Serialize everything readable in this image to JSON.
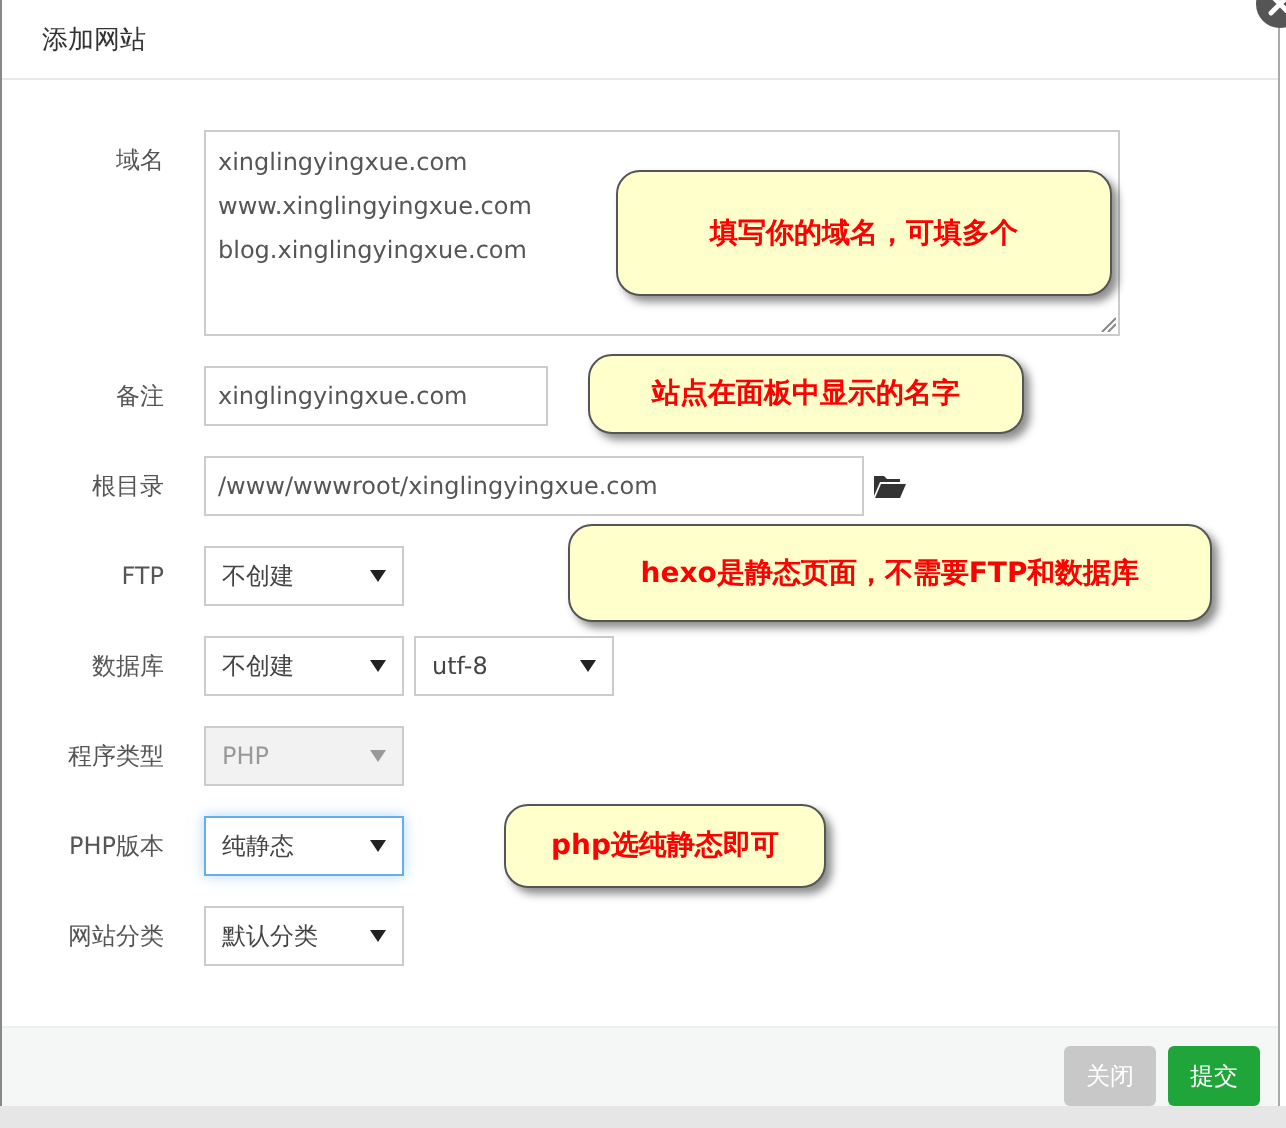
{
  "dialog": {
    "title": "添加网站"
  },
  "fields": [
    {
      "label": "域名",
      "kind": "textarea",
      "lines": [
        "xinglingyingxue.com",
        "www.xinglingyingxue.com",
        "blog.xinglingyingxue.com"
      ]
    },
    {
      "label": "备注",
      "kind": "input",
      "value": "xinglingyingxue.com"
    },
    {
      "label": "根目录",
      "kind": "path",
      "value": "/www/wwwroot/xinglingyingxue.com"
    },
    {
      "label": "FTP",
      "kind": "select",
      "selects": [
        {
          "value": "不创建",
          "disabled": false,
          "focused": false
        }
      ]
    },
    {
      "label": "数据库",
      "kind": "select",
      "selects": [
        {
          "value": "不创建",
          "disabled": false,
          "focused": false
        },
        {
          "value": "utf-8",
          "disabled": false,
          "focused": false
        }
      ]
    },
    {
      "label": "程序类型",
      "kind": "select",
      "selects": [
        {
          "value": "PHP",
          "disabled": true,
          "focused": false
        }
      ]
    },
    {
      "label": "PHP版本",
      "kind": "select",
      "selects": [
        {
          "value": "纯静态",
          "disabled": false,
          "focused": true
        }
      ]
    },
    {
      "label": "网站分类",
      "kind": "select",
      "selects": [
        {
          "value": "默认分类",
          "disabled": false,
          "focused": false
        }
      ]
    }
  ],
  "callouts": [
    {
      "text": "填写你的域名，可填多个"
    },
    {
      "text": "站点在面板中显示的名字"
    },
    {
      "text": "hexo是静态页面，不需要FTP和数据库"
    },
    {
      "text": "php选纯静态即可"
    }
  ],
  "buttons": [
    {
      "label": "关闭",
      "kind": "close"
    },
    {
      "label": "提交",
      "kind": "submit"
    }
  ]
}
